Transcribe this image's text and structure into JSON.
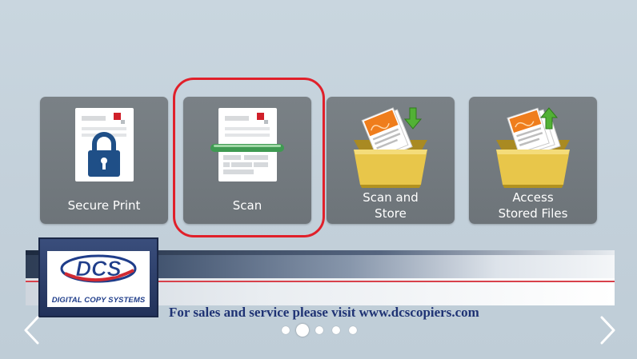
{
  "tiles": [
    {
      "label": "Secure Print",
      "icon": "lock-document-icon"
    },
    {
      "label": "Scan",
      "icon": "scanner-document-icon"
    },
    {
      "label": "Scan and\nStore",
      "icon": "scan-to-box-icon"
    },
    {
      "label": "Access\nStored Files",
      "icon": "stored-files-box-icon"
    }
  ],
  "banner": {
    "logo_text": "DCS",
    "logo_caption": "DIGITAL COPY SYSTEMS",
    "message": "For sales and service please visit www.dcscopiers.com"
  },
  "pager": {
    "total": 5,
    "active_index": 1
  },
  "colors": {
    "tile_bg": "#737a7f",
    "highlight": "#e0202a",
    "banner_text": "#1f3374",
    "logo_blue": "#1f3d8a",
    "logo_red": "#d12a33"
  }
}
